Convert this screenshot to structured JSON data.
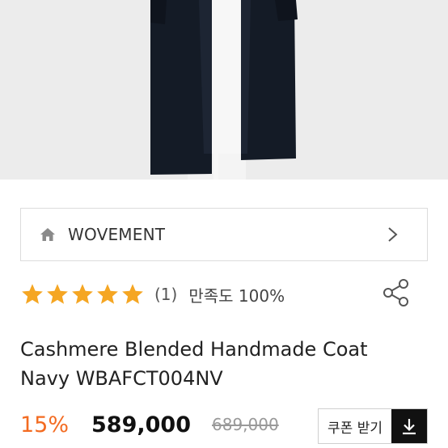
{
  "brand": {
    "name": "WOVEMENT"
  },
  "rating": {
    "stars": 5,
    "count": "(1)",
    "satisfaction": "만족도 100%"
  },
  "product": {
    "title": "Cashmere Blended Handmade Coat Navy WBAFCT004NV"
  },
  "price": {
    "discount": "15%",
    "current": "589,000",
    "original": "689,000"
  },
  "coupon": {
    "label": "쿠폰 받기"
  },
  "colors": {
    "accent": "#f36b21",
    "star": "#f5a623",
    "coat": "#141b26"
  },
  "icons": [
    "home-icon",
    "chevron-right-icon",
    "star-icon",
    "share-icon",
    "download-icon"
  ]
}
